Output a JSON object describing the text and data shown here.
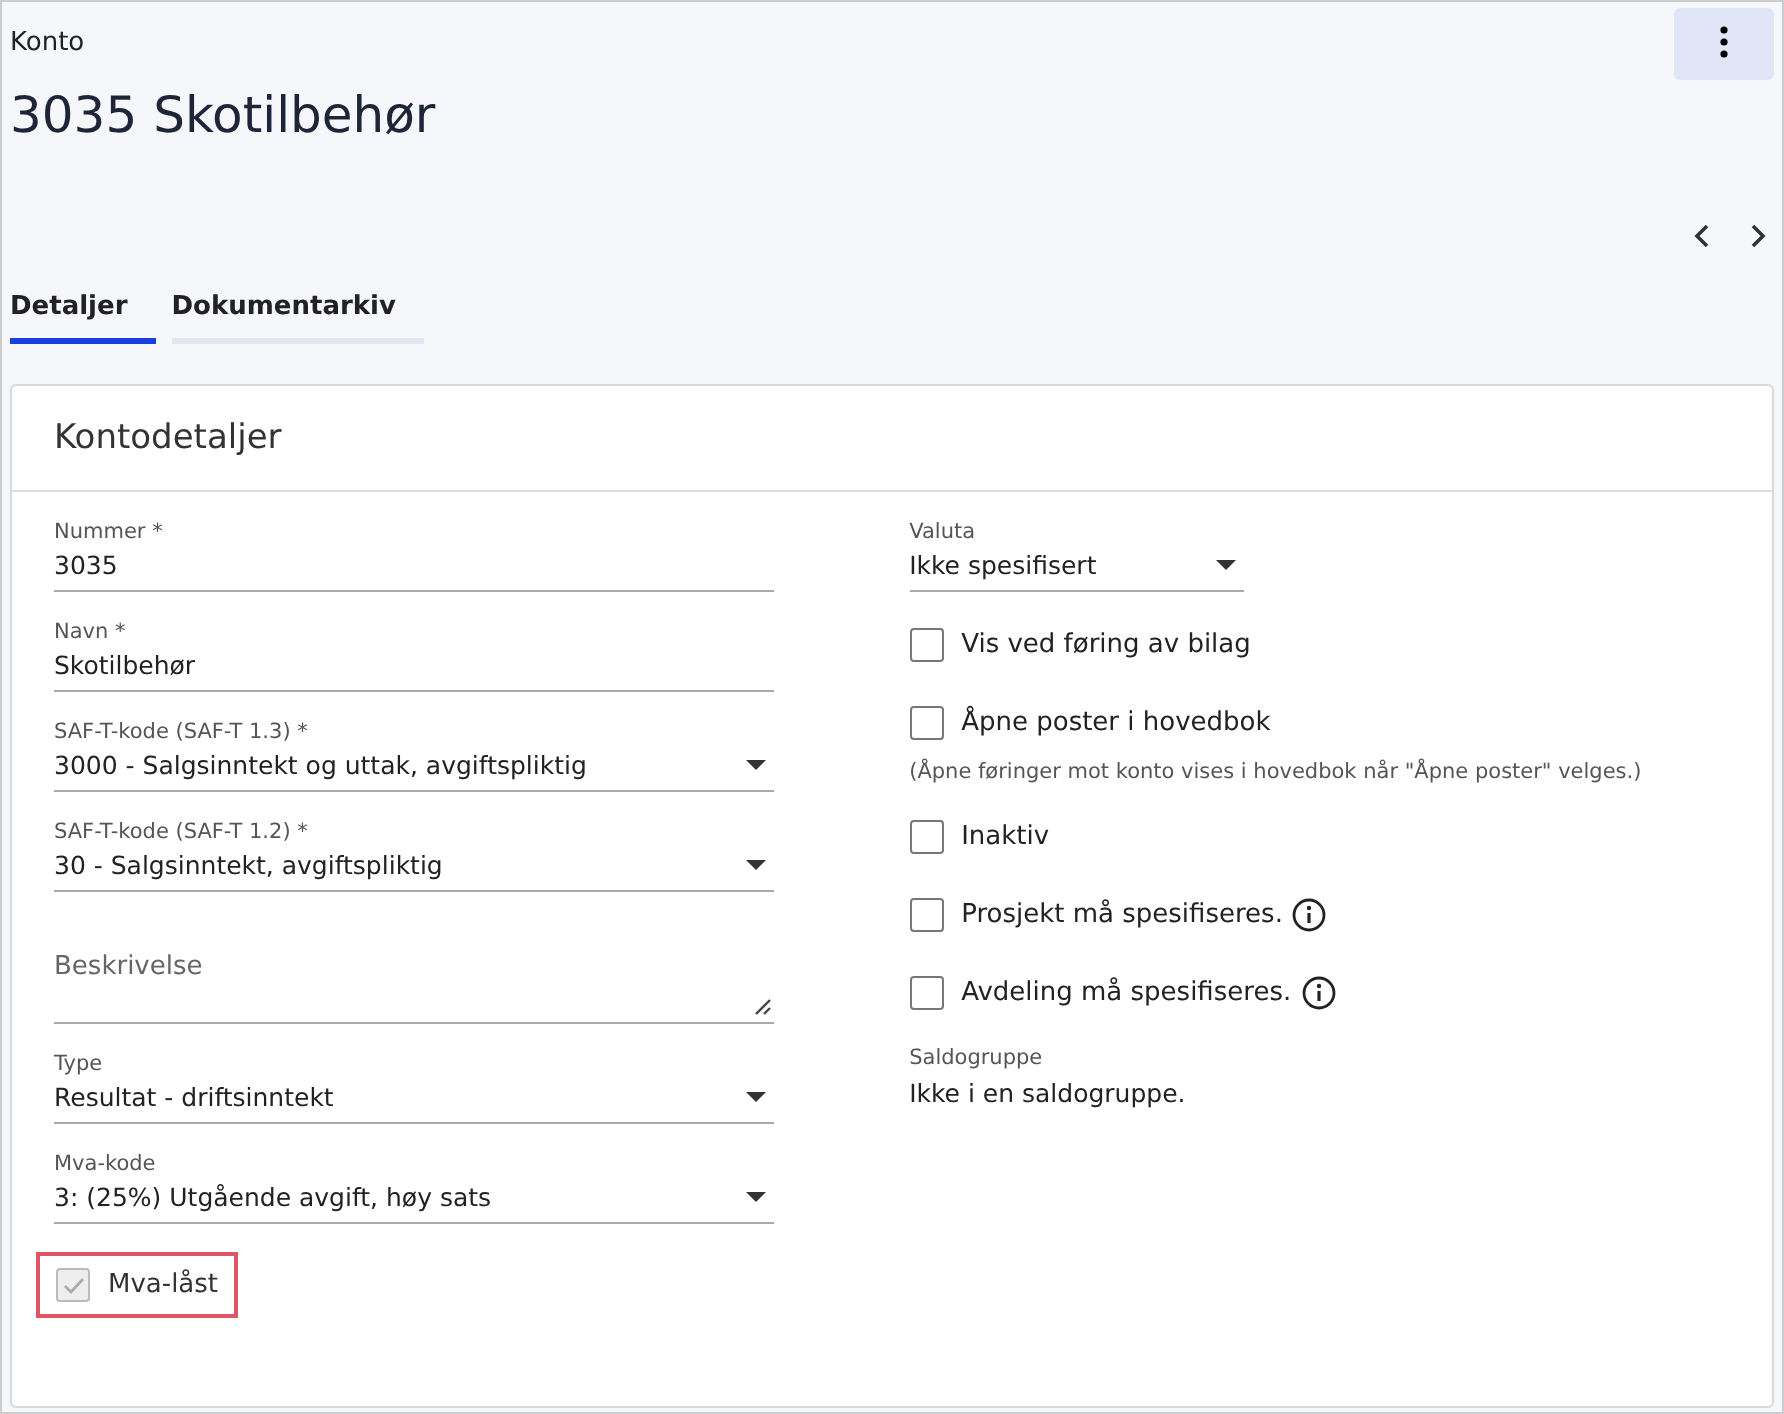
{
  "header": {
    "breadcrumb": "Konto",
    "title": "3035 Skotilbehør"
  },
  "tabs": [
    {
      "label": "Detaljer",
      "selected": true
    },
    {
      "label": "Dokumentarkiv",
      "selected": false
    }
  ],
  "card": {
    "title": "Kontodetaljer"
  },
  "left_fields": [
    {
      "kind": "text",
      "label": "Nummer *",
      "value": "3035"
    },
    {
      "kind": "text",
      "label": "Navn *",
      "value": "Skotilbehør"
    },
    {
      "kind": "select",
      "label": "SAF-T-kode (SAF-T 1.3) *",
      "value": "3000 - Salgsinntekt og uttak, avgiftspliktig"
    },
    {
      "kind": "select",
      "label": "SAF-T-kode (SAF-T 1.2) *",
      "value": "30 - Salgsinntekt, avgiftspliktig"
    },
    {
      "kind": "textarea",
      "placeholder": "Beskrivelse"
    },
    {
      "kind": "select",
      "label": "Type",
      "value": "Resultat - driftsinntekt"
    },
    {
      "kind": "select",
      "label": "Mva-kode",
      "value": "3: (25%) Utgående avgift, høy sats"
    },
    {
      "kind": "checkbox",
      "label": "Mva-låst",
      "checked": true,
      "disabled": true,
      "highlighted": true
    }
  ],
  "right_fields": [
    {
      "kind": "select",
      "label": "Valuta",
      "value": "Ikke spesifisert"
    },
    {
      "kind": "checkbox",
      "label": "Vis ved føring av bilag",
      "checked": false,
      "disabled": false,
      "info": false
    },
    {
      "kind": "checkbox",
      "label": "Åpne poster i hovedbok",
      "checked": false,
      "disabled": false,
      "info": false,
      "note": "(Åpne føringer mot konto vises i hovedbok når \"Åpne poster\" velges.)"
    },
    {
      "kind": "checkbox",
      "label": "Inaktiv",
      "checked": false,
      "disabled": false,
      "info": false
    },
    {
      "kind": "checkbox",
      "label": "Prosjekt må spesifiseres.",
      "checked": false,
      "disabled": false,
      "info": true
    },
    {
      "kind": "checkbox",
      "label": "Avdeling må spesifiseres.",
      "checked": false,
      "disabled": false,
      "info": true
    },
    {
      "kind": "readonly",
      "label": "Saldogruppe",
      "value": "Ikke i en saldogruppe."
    }
  ]
}
